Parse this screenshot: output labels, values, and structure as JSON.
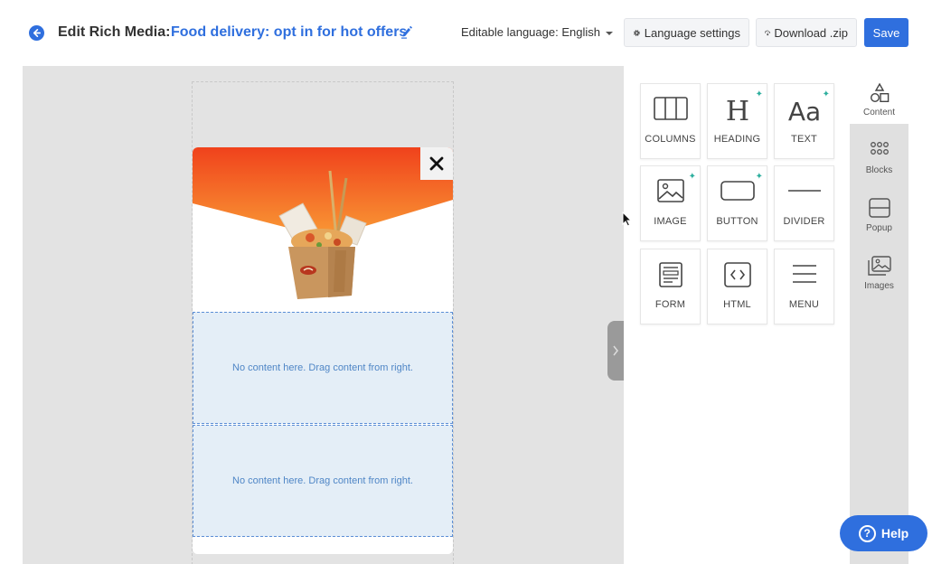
{
  "header": {
    "title_prefix": "Edit Rich Media:",
    "campaign_name": "Food delivery: opt in for hot offers",
    "editable_language": "Editable language: English",
    "language_settings_label": "Language settings",
    "download_label": "Download .zip",
    "save_label": "Save"
  },
  "canvas": {
    "dropzone_text_1": "No content here. Drag content from right.",
    "dropzone_text_2": "No content here. Drag content from right."
  },
  "content_tiles": [
    {
      "label": "COLUMNS",
      "icon": "columns-icon"
    },
    {
      "label": "HEADING",
      "icon": "heading-icon"
    },
    {
      "label": "TEXT",
      "icon": "text-icon"
    },
    {
      "label": "IMAGE",
      "icon": "image-icon"
    },
    {
      "label": "BUTTON",
      "icon": "button-icon"
    },
    {
      "label": "DIVIDER",
      "icon": "divider-icon"
    },
    {
      "label": "FORM",
      "icon": "form-icon"
    },
    {
      "label": "HTML",
      "icon": "html-icon"
    },
    {
      "label": "MENU",
      "icon": "menu-icon"
    }
  ],
  "side_nav": [
    {
      "label": "Content",
      "icon": "shapes-icon",
      "active": true
    },
    {
      "label": "Blocks",
      "icon": "blocks-icon"
    },
    {
      "label": "Popup",
      "icon": "popup-icon"
    },
    {
      "label": "Images",
      "icon": "images-icon"
    }
  ],
  "help_label": "Help",
  "colors": {
    "accent": "#2f6fde",
    "dropzone_bg": "#e4eef7",
    "hero_orange": "#f24b1f"
  }
}
